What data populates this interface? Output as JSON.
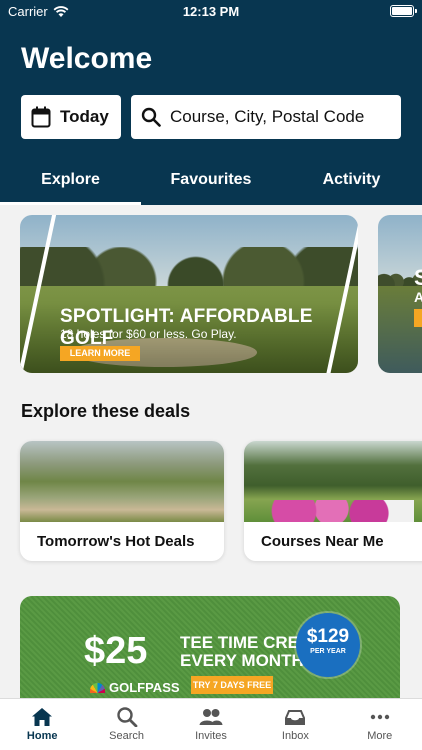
{
  "status_bar": {
    "carrier": "Carrier",
    "time": "12:13 PM"
  },
  "header": {
    "title": "Welcome",
    "date_button": "Today",
    "search_placeholder": "Course, City, Postal Code",
    "color": "#083650"
  },
  "tabs": [
    {
      "label": "Explore",
      "active": true
    },
    {
      "label": "Favourites",
      "active": false
    },
    {
      "label": "Activity",
      "active": false
    }
  ],
  "spotlight": {
    "title": "SPOTLIGHT: AFFORDABLE GOLF",
    "subtitle": "18 holes for $60 or less. Go Play.",
    "cta": "LEARN MORE"
  },
  "spotlight_2": {
    "line1": "S",
    "line2": "A"
  },
  "deals": {
    "title": "Explore these deals",
    "cards": [
      {
        "label": "Tomorrow's Hot Deals"
      },
      {
        "label": "Courses Near Me"
      }
    ]
  },
  "promo": {
    "amount": "$25",
    "line1": "TEE TIME CREDIT",
    "line2": "EVERY MONTH",
    "brand": "GOLFPASS",
    "cta": "TRY 7 DAYS FREE",
    "price": "$129",
    "price_period": "PER YEAR"
  },
  "tab_bar": [
    {
      "label": "Home",
      "icon": "home-icon",
      "active": true
    },
    {
      "label": "Search",
      "icon": "search-icon",
      "active": false
    },
    {
      "label": "Invites",
      "icon": "invites-icon",
      "active": false
    },
    {
      "label": "Inbox",
      "icon": "inbox-icon",
      "active": false
    },
    {
      "label": "More",
      "icon": "more-icon",
      "active": false
    }
  ],
  "colors": {
    "accent": "#f5a623",
    "brand": "#083650"
  }
}
